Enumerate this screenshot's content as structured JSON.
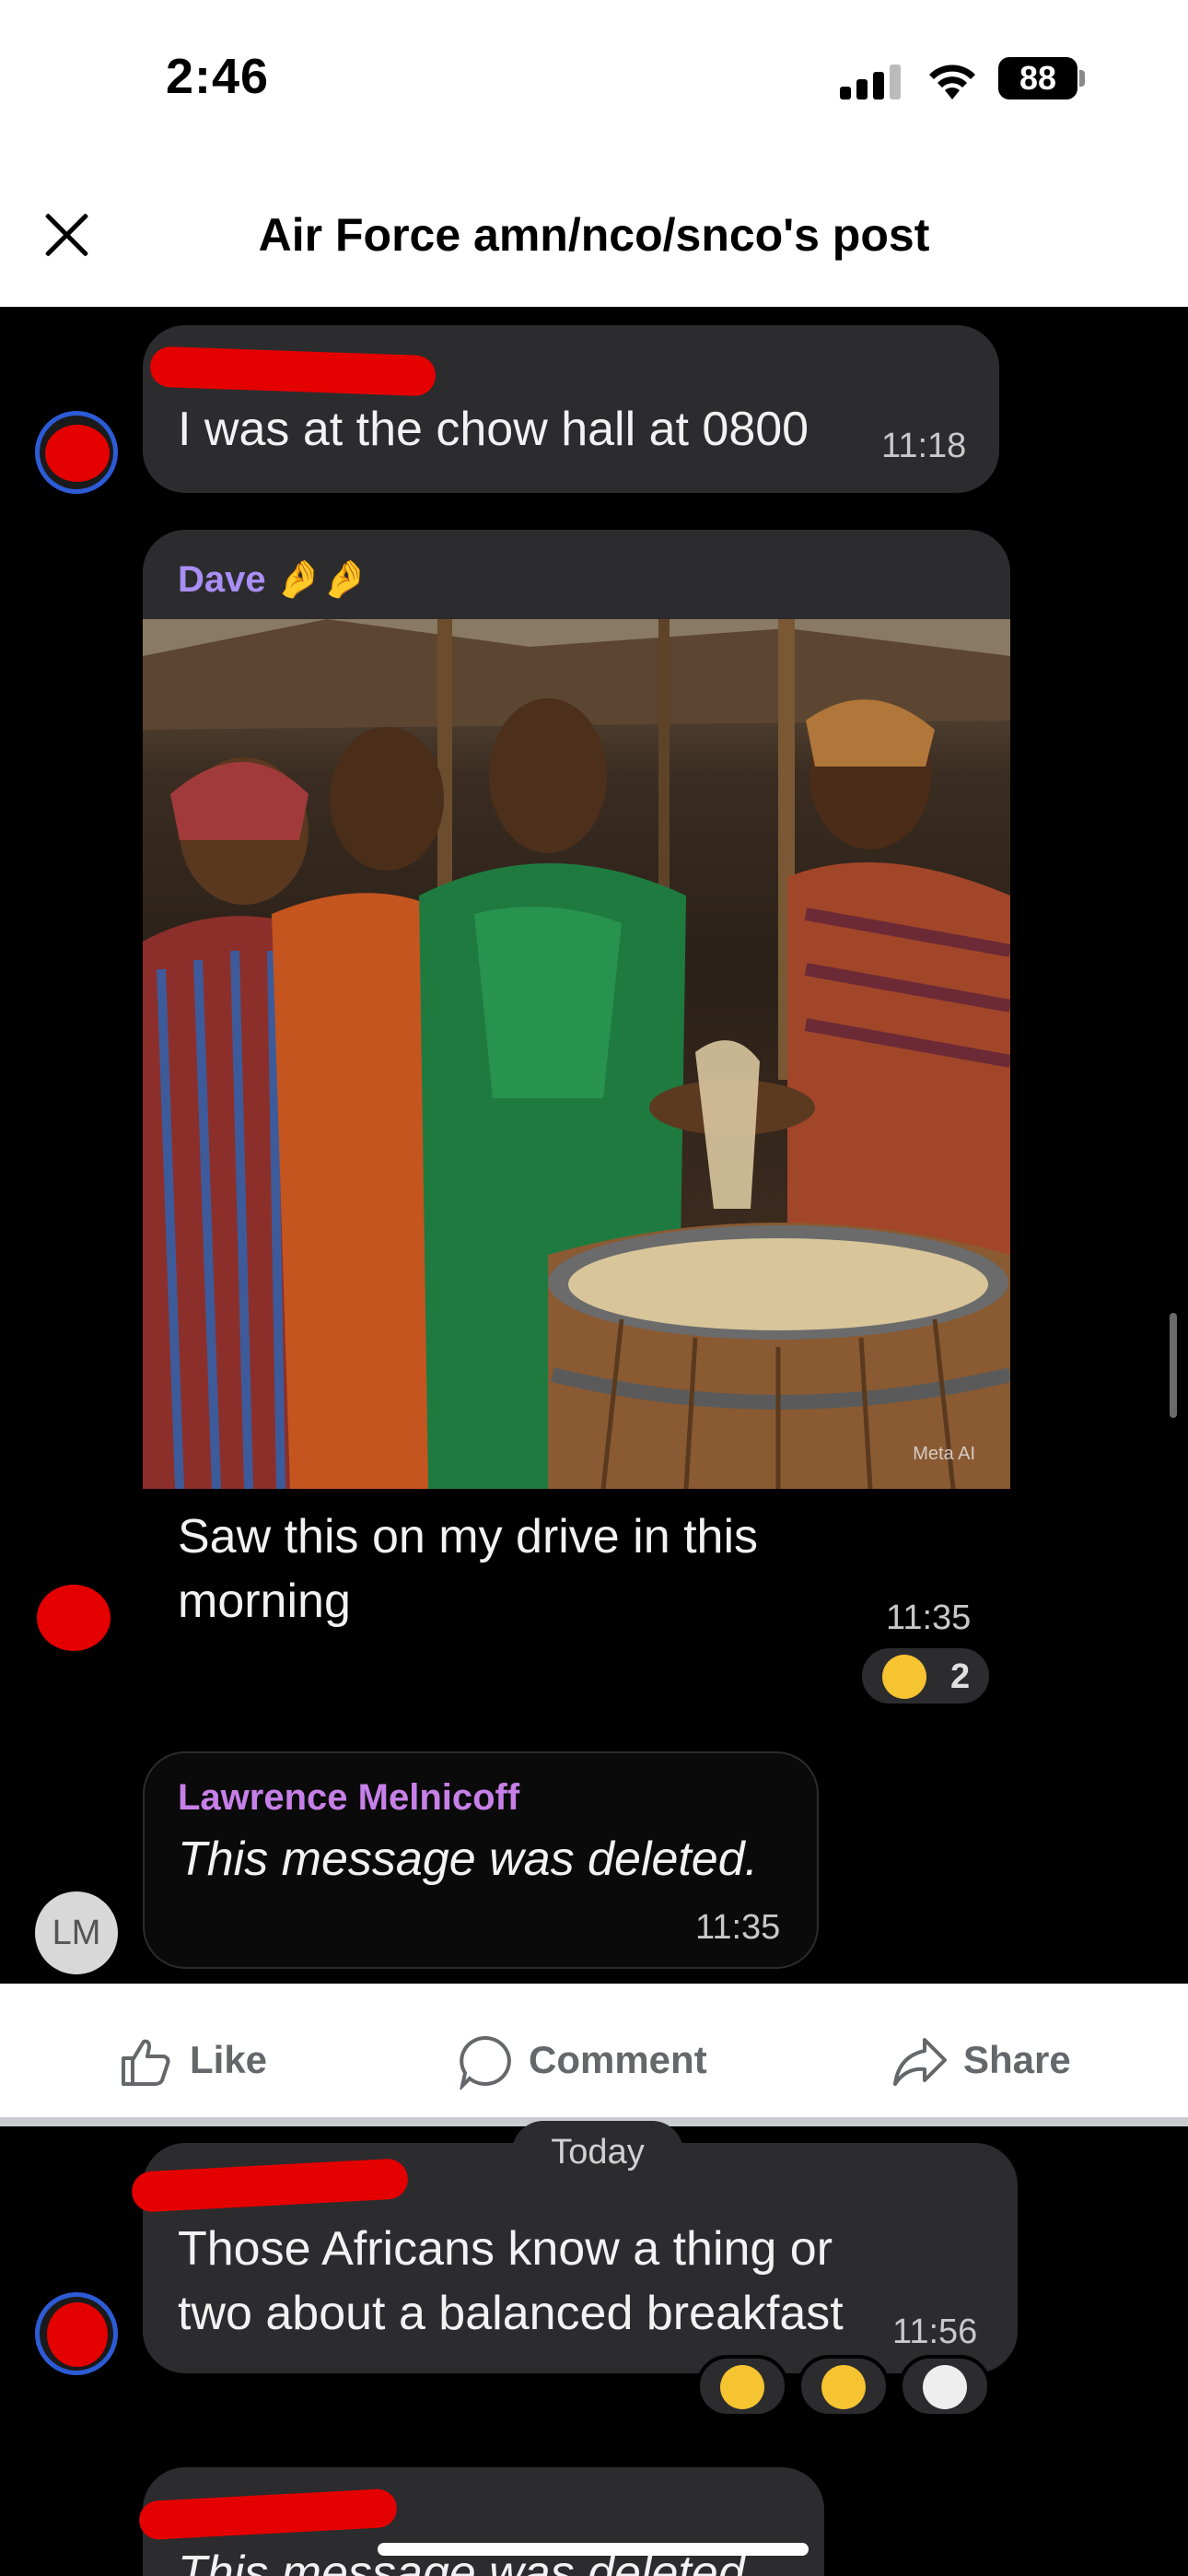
{
  "status_bar": {
    "time": "2:46",
    "battery": "88"
  },
  "header": {
    "title": "Air Force amn/nco/snco's post"
  },
  "messages": [
    {
      "sender": "",
      "text": "I was at the chow hall at 0800",
      "time": "11:18"
    },
    {
      "sender": "Dave 🤌🤌",
      "text": "Saw this on my drive in this morning",
      "time": "11:35",
      "image_watermark": "Meta AI",
      "reactions": [
        {
          "emoji": "😂",
          "count": "2"
        }
      ]
    },
    {
      "sender": "Lawrence Melnicoff",
      "avatar_initials": "LM",
      "text": "This message was deleted.",
      "time": "11:35"
    },
    {
      "date_divider": "Today"
    },
    {
      "sender": "",
      "text": "Those Africans know a thing or two about a balanced breakfast",
      "time": "11:56",
      "reactions": [
        {
          "emoji": "🤨"
        },
        {
          "emoji": "😂"
        },
        {
          "emoji": "💀"
        }
      ]
    },
    {
      "sender": "",
      "text": "This message was deleted"
    }
  ],
  "actions": {
    "like": "Like",
    "comment": "Comment",
    "share": "Share"
  },
  "colors": {
    "sender_purple": "#a98ef5",
    "bubble": "#2c2c2e",
    "facebook_gray": "#65676b"
  }
}
